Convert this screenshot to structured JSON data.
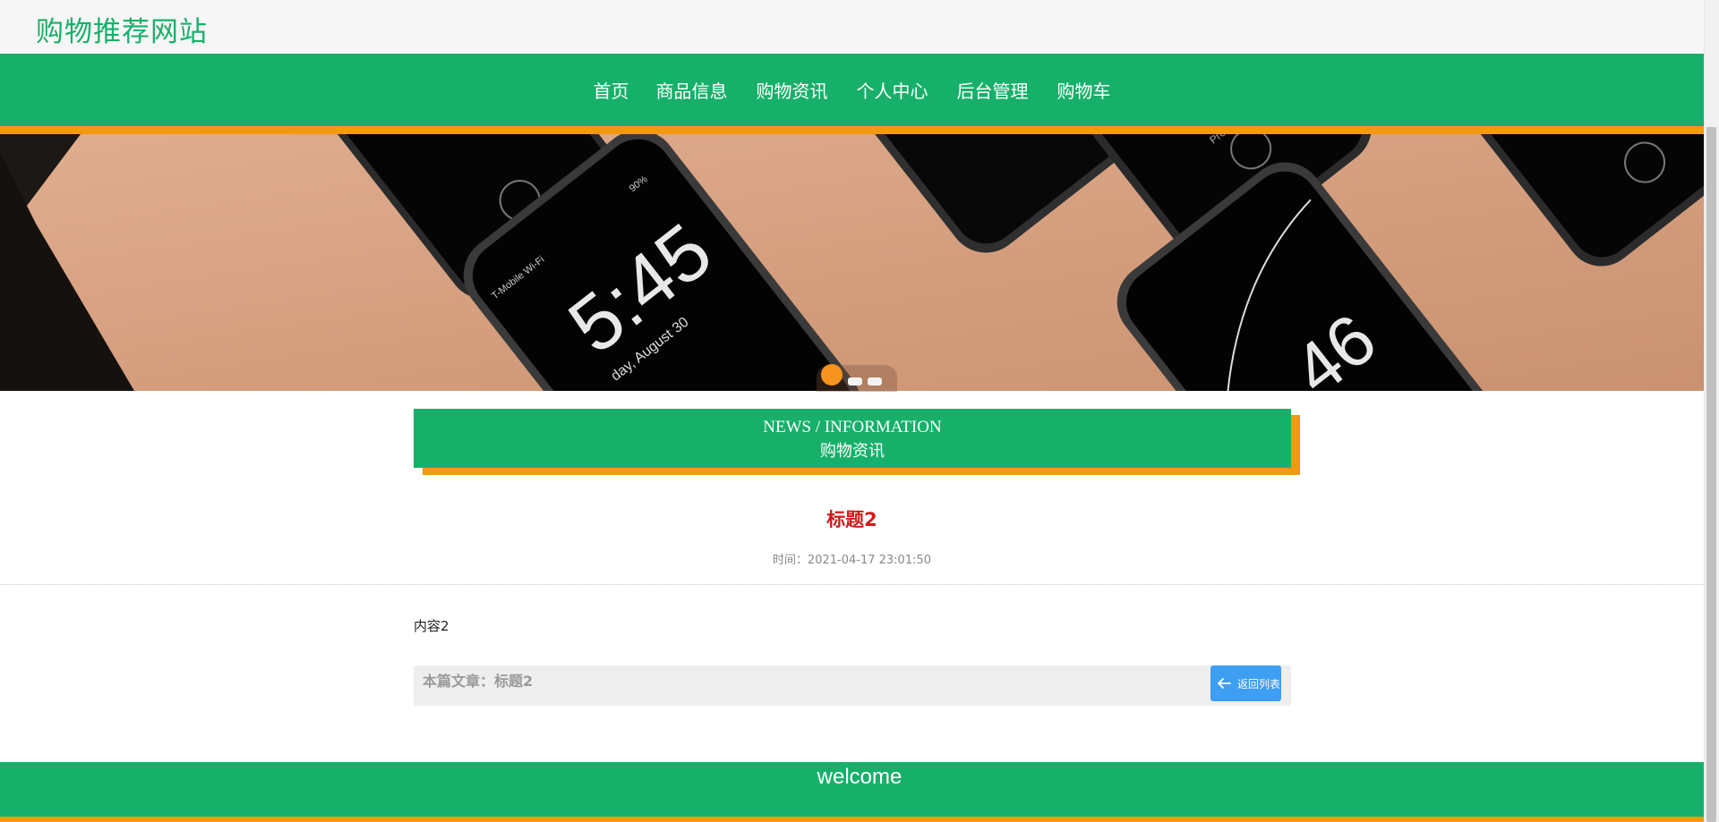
{
  "site": {
    "title": "购物推荐网站"
  },
  "nav": {
    "items": [
      "首页",
      "商品信息",
      "购物资讯",
      "个人中心",
      "后台管理",
      "购物车"
    ]
  },
  "banner": {
    "lock_screen_time": "5:45",
    "lock_screen_date": "day, August 30",
    "carrier": "T-Mobile Wi-Fi",
    "battery": "90%",
    "second_time": "46",
    "hint": "Press home to"
  },
  "section": {
    "en": "NEWS / INFORMATION",
    "cn": "购物资讯"
  },
  "article": {
    "title": "标题2",
    "time": "时间：2021-04-17 23:01:50",
    "body": "内容2"
  },
  "footer_bar": {
    "this_article": "本篇文章：标题2",
    "back_label": "返回列表"
  },
  "welcome": "welcome",
  "colors": {
    "brand_green": "#17b06a",
    "accent_orange": "#f39811",
    "title_red": "#d01a1a",
    "button_blue": "#3e9ef2"
  }
}
